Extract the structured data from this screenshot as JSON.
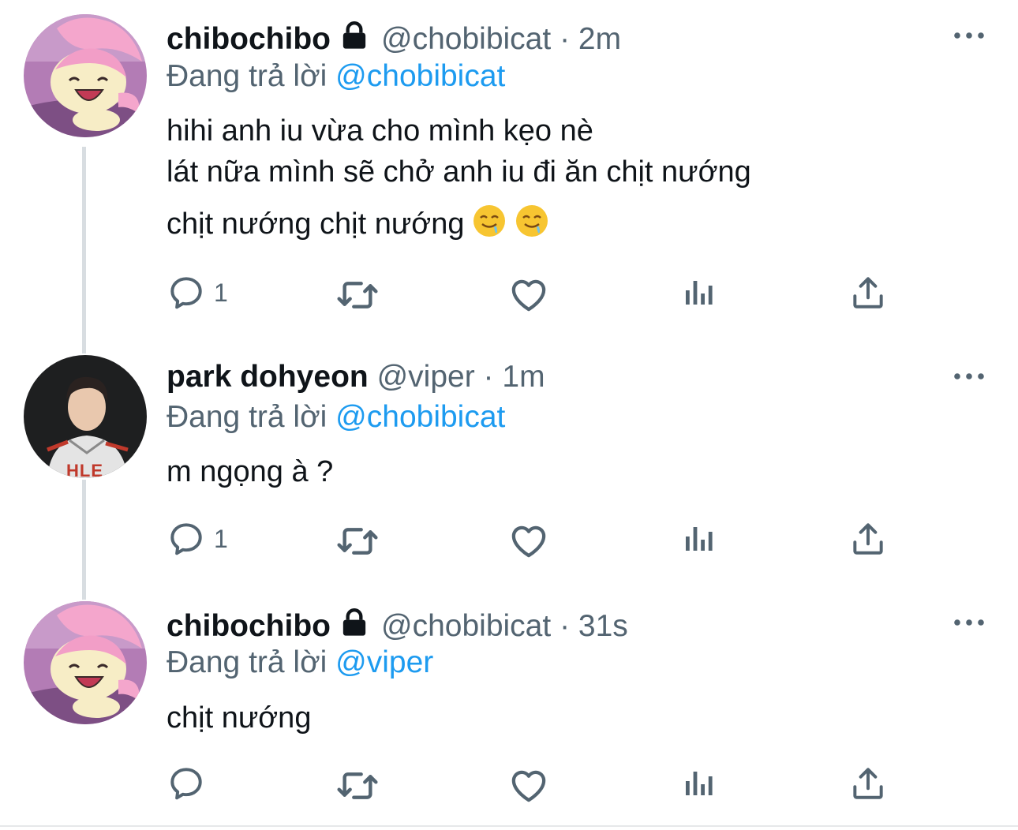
{
  "tweets": [
    {
      "display_name": "chibochibo",
      "handle": "@chobibicat",
      "separator": "·",
      "time": "2m",
      "locked": true,
      "reply_prefix": "Đang trả lời",
      "reply_to": "@chobibicat",
      "lines": [
        "hihi anh iu vừa cho mình kẹo nè",
        "lát nữa mình sẽ chở anh iu đi ăn chịt nướng",
        "chịt nướng chịt nướng"
      ],
      "emoji": [
        "drooling-face",
        "drooling-face"
      ],
      "reply_count": "1",
      "avatar": "pink-cartoon-cat"
    },
    {
      "display_name": "park dohyeon",
      "handle": "@viper",
      "separator": "·",
      "time": "1m",
      "locked": false,
      "reply_prefix": "Đang trả lời",
      "reply_to": "@chobibicat",
      "lines": [
        "m ngọng à ?"
      ],
      "reply_count": "1",
      "avatar": "person-photo",
      "jersey_text": "HLE"
    },
    {
      "display_name": "chibochibo",
      "handle": "@chobibicat",
      "separator": "·",
      "time": "31s",
      "locked": true,
      "reply_prefix": "Đang trả lời",
      "reply_to": "@viper",
      "lines": [
        "chịt nướng"
      ],
      "reply_count": "",
      "avatar": "pink-cartoon-cat"
    }
  ],
  "colors": {
    "text": "#0f1419",
    "secondary": "#536471",
    "accent": "#1d9bf0",
    "thread_line": "#d8dde1"
  }
}
